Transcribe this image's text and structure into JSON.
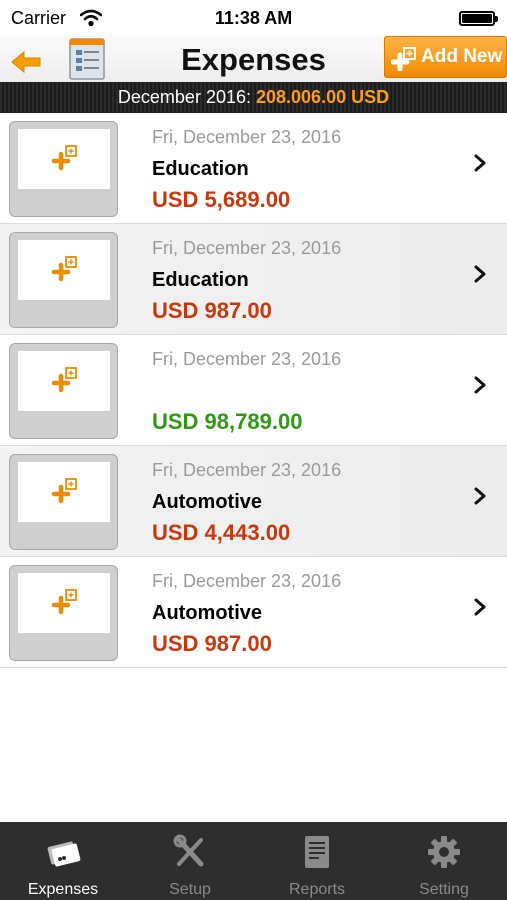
{
  "status_bar": {
    "carrier": "Carrier",
    "time": "11:38 AM"
  },
  "nav": {
    "title": "Expenses",
    "add_new_label": "Add New"
  },
  "summary": {
    "label": "December 2016:",
    "amount": "208.006.00 USD"
  },
  "expenses": [
    {
      "date": "Fri, December 23, 2016",
      "category": "Education",
      "amount": "USD 5,689.00",
      "amount_color": "red"
    },
    {
      "date": "Fri, December 23, 2016",
      "category": "Education",
      "amount": "USD 987.00",
      "amount_color": "red"
    },
    {
      "date": "Fri, December 23, 2016",
      "category": "",
      "amount": "USD 98,789.00",
      "amount_color": "green"
    },
    {
      "date": "Fri, December 23, 2016",
      "category": "Automotive",
      "amount": "USD 4,443.00",
      "amount_color": "red"
    },
    {
      "date": "Fri, December 23, 2016",
      "category": "Automotive",
      "amount": "USD 987.00",
      "amount_color": "red"
    }
  ],
  "tabs": [
    {
      "label": "Expenses",
      "icon": "cards-icon",
      "active": true
    },
    {
      "label": "Setup",
      "icon": "tools-icon",
      "active": false
    },
    {
      "label": "Reports",
      "icon": "report-icon",
      "active": false
    },
    {
      "label": "Setting",
      "icon": "gear-icon",
      "active": false
    }
  ],
  "colors": {
    "accent": "#f08a00",
    "expense_red": "#c8380c",
    "income_green": "#2e9a14",
    "tab_bar": "#2e2e2e"
  }
}
